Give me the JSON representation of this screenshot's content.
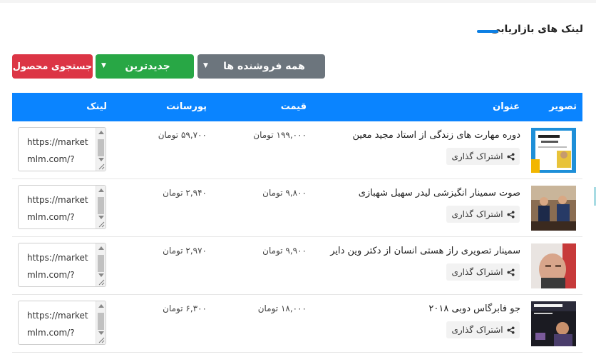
{
  "section": {
    "title": "لینک های بازاریابی"
  },
  "filters": {
    "search_button": "جستجوی محصول",
    "sort_select": "جدیدترین",
    "seller_select": "همه فروشنده ها"
  },
  "table": {
    "headers": {
      "image": "تصویر",
      "title": "عنوان",
      "price": "قیمت",
      "percent": "پورسانت",
      "link": "لینک"
    },
    "share_label": "اشتراک گذاری",
    "rows": [
      {
        "title": "دوره مهارت های زندگی از استاد مجید معین",
        "price": "۱۹۹,۰۰۰ تومان",
        "percent": "۵۹,۷۰۰ تومان",
        "link": "https://marketmlm.com/?"
      },
      {
        "title": "صوت سمینار انگیزشی لیدر سهیل شهبازی",
        "price": "۹,۸۰۰ تومان",
        "percent": "۲,۹۴۰ تومان",
        "link": "https://marketmlm.com/?"
      },
      {
        "title": "سمینار تصویری راز هستی انسان از دکتر وین دایر",
        "price": "۹,۹۰۰ تومان",
        "percent": "۲,۹۷۰ تومان",
        "link": "https://marketmlm.com/?"
      },
      {
        "title": "جو فابرگاس دوبی ۲۰۱۸",
        "price": "۱۸,۰۰۰ تومان",
        "percent": "۶,۳۰۰ تومان",
        "link": "https://marketmlm.com/?"
      }
    ]
  },
  "colors": {
    "primary": "#0a84ff",
    "danger": "#dc3545",
    "success": "#28a745",
    "secondary": "#6c757d"
  },
  "icons": {
    "share": "share-icon",
    "caret": "caret-down-icon"
  }
}
